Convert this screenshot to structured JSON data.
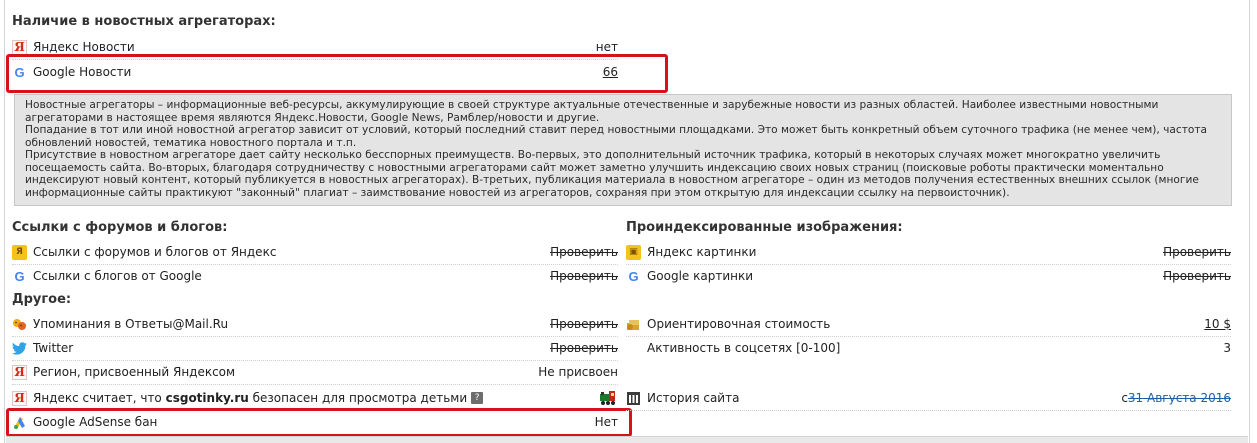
{
  "aggregators": {
    "heading": "Наличие в новостных агрегаторах:",
    "yandex_news": {
      "label": "Яндекс Новости",
      "value": "нет"
    },
    "google_news": {
      "label": "Google Новости",
      "value": "66"
    }
  },
  "info": {
    "p1": "Новостные агрегаторы – информационные веб-ресурсы, аккумулирующие в своей структуре актуальные отечественные и зарубежные новости из разных областей. Наиболее известными новостными агрегаторами в настоящее время являются Яндекс.Новости, Google News, Рамблер/новости и другие.",
    "p2": "Попадание в тот или иной новостной агрегатор зависит от условий, который последний ставит перед новостными площадками. Это может быть конкретный объем суточного трафика (не менее чем), частота обновлений новостей, тематика новостного портала и т.п.",
    "p3": "Присутствие в новостном агрегаторе дает сайту несколько бесспорных преимуществ. Во-первых, это дополнительный источник трафика, который в некоторых случаях может многократно увеличить посещаемость сайта. Во-вторых, благодаря сотрудничеству с новостными агрегаторами сайт может заметно улучшить индексацию своих новых страниц (поисковые роботы практически моментально индексируют новый контент, который публикуется в новостных агрегаторах). В-третьих, публикация материала в новостном агрегаторе – один из методов получения естественных внешних ссылок (многие информационные сайты практикуют \"законный\" плагиат – заимствование новостей из агрегаторов, сохраняя при этом открытую для индексации ссылку на первоисточник)."
  },
  "forums": {
    "heading": "Ссылки с форумов и блогов:",
    "yandex": {
      "label": "Ссылки с форумов и блогов от Яндекс",
      "action": "Проверить"
    },
    "google": {
      "label": "Ссылки с блогов от Google",
      "action": "Проверить"
    }
  },
  "images": {
    "heading": "Проиндексированные изображения:",
    "yandex": {
      "label": "Яндекс картинки",
      "action": "Проверить"
    },
    "google": {
      "label": "Google картинки",
      "action": "Проверить"
    }
  },
  "other": {
    "heading": "Другое:",
    "mail_answers": {
      "label": "Упоминания в Ответы@Mail.Ru",
      "action": "Проверить"
    },
    "twitter": {
      "label": "Twitter",
      "action": "Проверить"
    },
    "region": {
      "label": "Регион, присвоенный Яндексом",
      "value": "Не присвоен"
    },
    "kids": {
      "prefix": "Яндекс считает, что ",
      "domain": "csgotinky.ru",
      "suffix": " безопасен для просмотра детьми",
      "help": "?"
    },
    "adsense": {
      "label": "Google AdSense бан",
      "value": "Нет"
    },
    "cost": {
      "label": "Ориентировочная стоимость",
      "value": "10 $"
    },
    "social": {
      "label": "Активность в соцсетях [0-100]",
      "value": "3"
    },
    "history": {
      "label": "История сайта",
      "prefix": "с ",
      "date": "31 Августа 2016"
    }
  },
  "icons": {
    "yandex": "yandex-icon",
    "google": "google-icon",
    "yandex_images": "yandex-images-icon",
    "mail_answers": "mail-answers-icon",
    "twitter": "twitter-bird-icon",
    "kids": "train-icon",
    "adsense": "adsense-icon",
    "cost": "money-icon",
    "history": "archive-icon"
  },
  "colors": {
    "highlight": "#d9111b",
    "link": "#1f5fa6",
    "info_bg": "#e4e4e4"
  }
}
